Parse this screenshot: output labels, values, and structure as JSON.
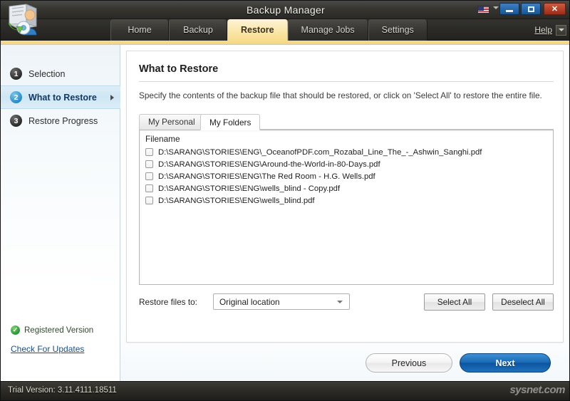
{
  "window": {
    "title": "Backup Manager",
    "app_icon": "backup-manager-icon",
    "language_flag": "us-flag-icon",
    "minimize_label": "–",
    "maximize_label": "□",
    "close_label": "✕"
  },
  "nav": {
    "tabs": [
      {
        "label": "Home",
        "active": false
      },
      {
        "label": "Backup",
        "active": false
      },
      {
        "label": "Restore",
        "active": true
      },
      {
        "label": "Manage Jobs",
        "active": false
      },
      {
        "label": "Settings",
        "active": false
      }
    ],
    "help_label": "Help"
  },
  "sidebar": {
    "steps": [
      {
        "num": "1",
        "label": "Selection",
        "active": false
      },
      {
        "num": "2",
        "label": "What to Restore",
        "active": true
      },
      {
        "num": "3",
        "label": "Restore Progress",
        "active": false
      }
    ],
    "registered_label": "Registered Version",
    "registered_icon": "green-check-icon",
    "check_updates_label": "Check For Updates"
  },
  "main": {
    "page_title": "What to Restore",
    "description": "Specify the contents of the backup file that should be restored, or click on 'Select All' to restore the entire file.",
    "subtabs": [
      {
        "label": "My Personal",
        "active": false
      },
      {
        "label": "My Folders",
        "active": true
      }
    ],
    "list": {
      "column_header": "Filename",
      "rows": [
        {
          "checked": false,
          "filename": "D:\\SARANG\\STORIES\\ENG\\_OceanofPDF.com_Rozabal_Line_The_-_Ashwin_Sanghi.pdf"
        },
        {
          "checked": false,
          "filename": "D:\\SARANG\\STORIES\\ENG\\Around-the-World-in-80-Days.pdf"
        },
        {
          "checked": false,
          "filename": "D:\\SARANG\\STORIES\\ENG\\The Red Room - H.G. Wells.pdf"
        },
        {
          "checked": false,
          "filename": "D:\\SARANG\\STORIES\\ENG\\wells_blind - Copy.pdf"
        },
        {
          "checked": false,
          "filename": "D:\\SARANG\\STORIES\\ENG\\wells_blind.pdf"
        }
      ]
    },
    "restore_to_label": "Restore files to:",
    "restore_to_value": "Original location",
    "select_all_label": "Select All",
    "deselect_all_label": "Deselect All"
  },
  "footer": {
    "previous_label": "Previous",
    "next_label": "Next"
  },
  "statusbar": {
    "trial_text": "Trial Version: 3.11.4111.18511",
    "watermark": "sysnet.com"
  }
}
